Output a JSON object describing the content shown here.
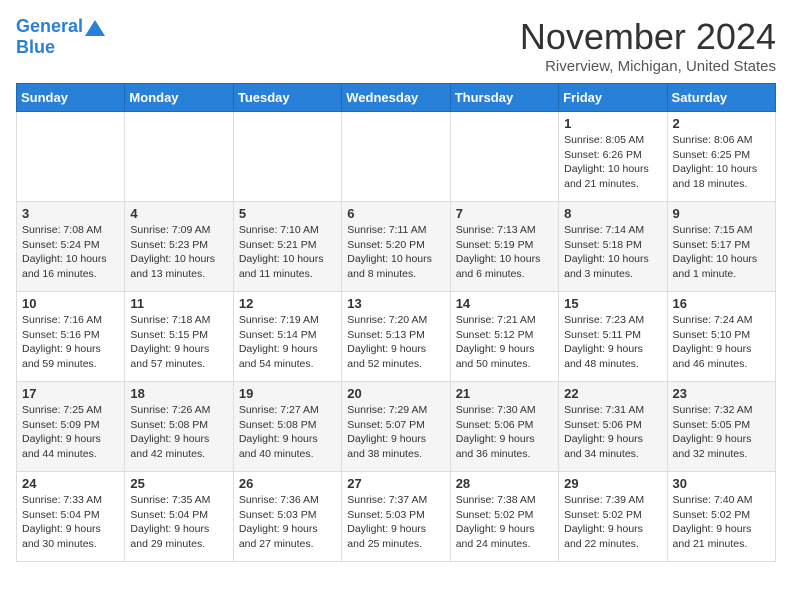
{
  "header": {
    "logo_line1": "General",
    "logo_line2": "Blue",
    "month": "November 2024",
    "location": "Riverview, Michigan, United States"
  },
  "weekdays": [
    "Sunday",
    "Monday",
    "Tuesday",
    "Wednesday",
    "Thursday",
    "Friday",
    "Saturday"
  ],
  "weeks": [
    [
      {
        "day": null
      },
      {
        "day": null
      },
      {
        "day": null
      },
      {
        "day": null
      },
      {
        "day": null
      },
      {
        "day": 1,
        "sunrise": "8:05 AM",
        "sunset": "6:26 PM",
        "daylight": "10 hours and 21 minutes."
      },
      {
        "day": 2,
        "sunrise": "8:06 AM",
        "sunset": "6:25 PM",
        "daylight": "10 hours and 18 minutes."
      }
    ],
    [
      {
        "day": 3,
        "sunrise": "7:08 AM",
        "sunset": "5:24 PM",
        "daylight": "10 hours and 16 minutes."
      },
      {
        "day": 4,
        "sunrise": "7:09 AM",
        "sunset": "5:23 PM",
        "daylight": "10 hours and 13 minutes."
      },
      {
        "day": 5,
        "sunrise": "7:10 AM",
        "sunset": "5:21 PM",
        "daylight": "10 hours and 11 minutes."
      },
      {
        "day": 6,
        "sunrise": "7:11 AM",
        "sunset": "5:20 PM",
        "daylight": "10 hours and 8 minutes."
      },
      {
        "day": 7,
        "sunrise": "7:13 AM",
        "sunset": "5:19 PM",
        "daylight": "10 hours and 6 minutes."
      },
      {
        "day": 8,
        "sunrise": "7:14 AM",
        "sunset": "5:18 PM",
        "daylight": "10 hours and 3 minutes."
      },
      {
        "day": 9,
        "sunrise": "7:15 AM",
        "sunset": "5:17 PM",
        "daylight": "10 hours and 1 minute."
      }
    ],
    [
      {
        "day": 10,
        "sunrise": "7:16 AM",
        "sunset": "5:16 PM",
        "daylight": "9 hours and 59 minutes."
      },
      {
        "day": 11,
        "sunrise": "7:18 AM",
        "sunset": "5:15 PM",
        "daylight": "9 hours and 57 minutes."
      },
      {
        "day": 12,
        "sunrise": "7:19 AM",
        "sunset": "5:14 PM",
        "daylight": "9 hours and 54 minutes."
      },
      {
        "day": 13,
        "sunrise": "7:20 AM",
        "sunset": "5:13 PM",
        "daylight": "9 hours and 52 minutes."
      },
      {
        "day": 14,
        "sunrise": "7:21 AM",
        "sunset": "5:12 PM",
        "daylight": "9 hours and 50 minutes."
      },
      {
        "day": 15,
        "sunrise": "7:23 AM",
        "sunset": "5:11 PM",
        "daylight": "9 hours and 48 minutes."
      },
      {
        "day": 16,
        "sunrise": "7:24 AM",
        "sunset": "5:10 PM",
        "daylight": "9 hours and 46 minutes."
      }
    ],
    [
      {
        "day": 17,
        "sunrise": "7:25 AM",
        "sunset": "5:09 PM",
        "daylight": "9 hours and 44 minutes."
      },
      {
        "day": 18,
        "sunrise": "7:26 AM",
        "sunset": "5:08 PM",
        "daylight": "9 hours and 42 minutes."
      },
      {
        "day": 19,
        "sunrise": "7:27 AM",
        "sunset": "5:08 PM",
        "daylight": "9 hours and 40 minutes."
      },
      {
        "day": 20,
        "sunrise": "7:29 AM",
        "sunset": "5:07 PM",
        "daylight": "9 hours and 38 minutes."
      },
      {
        "day": 21,
        "sunrise": "7:30 AM",
        "sunset": "5:06 PM",
        "daylight": "9 hours and 36 minutes."
      },
      {
        "day": 22,
        "sunrise": "7:31 AM",
        "sunset": "5:06 PM",
        "daylight": "9 hours and 34 minutes."
      },
      {
        "day": 23,
        "sunrise": "7:32 AM",
        "sunset": "5:05 PM",
        "daylight": "9 hours and 32 minutes."
      }
    ],
    [
      {
        "day": 24,
        "sunrise": "7:33 AM",
        "sunset": "5:04 PM",
        "daylight": "9 hours and 30 minutes."
      },
      {
        "day": 25,
        "sunrise": "7:35 AM",
        "sunset": "5:04 PM",
        "daylight": "9 hours and 29 minutes."
      },
      {
        "day": 26,
        "sunrise": "7:36 AM",
        "sunset": "5:03 PM",
        "daylight": "9 hours and 27 minutes."
      },
      {
        "day": 27,
        "sunrise": "7:37 AM",
        "sunset": "5:03 PM",
        "daylight": "9 hours and 25 minutes."
      },
      {
        "day": 28,
        "sunrise": "7:38 AM",
        "sunset": "5:02 PM",
        "daylight": "9 hours and 24 minutes."
      },
      {
        "day": 29,
        "sunrise": "7:39 AM",
        "sunset": "5:02 PM",
        "daylight": "9 hours and 22 minutes."
      },
      {
        "day": 30,
        "sunrise": "7:40 AM",
        "sunset": "5:02 PM",
        "daylight": "9 hours and 21 minutes."
      }
    ]
  ]
}
